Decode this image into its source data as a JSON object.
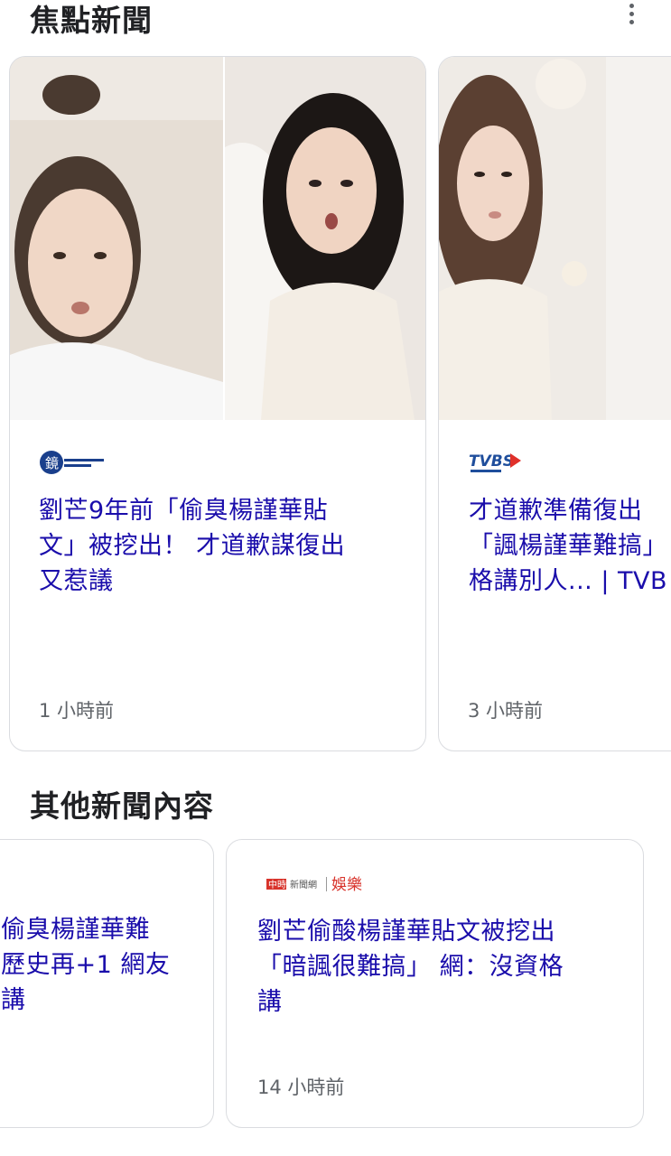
{
  "sections": {
    "top_stories_title": "焦點新聞",
    "other_news_title": "其他新聞內容"
  },
  "top_stories": [
    {
      "source": "鏡新聞 MIRROR MEDIA",
      "headline": "劉芒9年前「偷臭楊謹華貼\n文」被挖出！ 才道歉謀復出\n又惹議",
      "time": "1 小時前"
    },
    {
      "source": "TVBS 新聞網",
      "headline": "才道歉準備復出\n「諷楊謹華難搞」\n格講別人... | TVB",
      "time": "3 小時前"
    }
  ],
  "other_news": [
    {
      "headline": "偷臭楊謹華難\n歷史再+1 網友\n講"
    },
    {
      "source": "中時新聞網 | 娛樂",
      "headline": "劉芒偷酸楊謹華貼文被挖出\n「暗諷很難搞」 網：沒資格\n講",
      "time": "14 小時前"
    }
  ],
  "icons": {
    "more": "more-vert-icon",
    "person_photo": "person-photo"
  },
  "colors": {
    "headline": "#1a0dab",
    "title": "#202124",
    "meta": "#5f6368",
    "border": "#dadce0"
  }
}
